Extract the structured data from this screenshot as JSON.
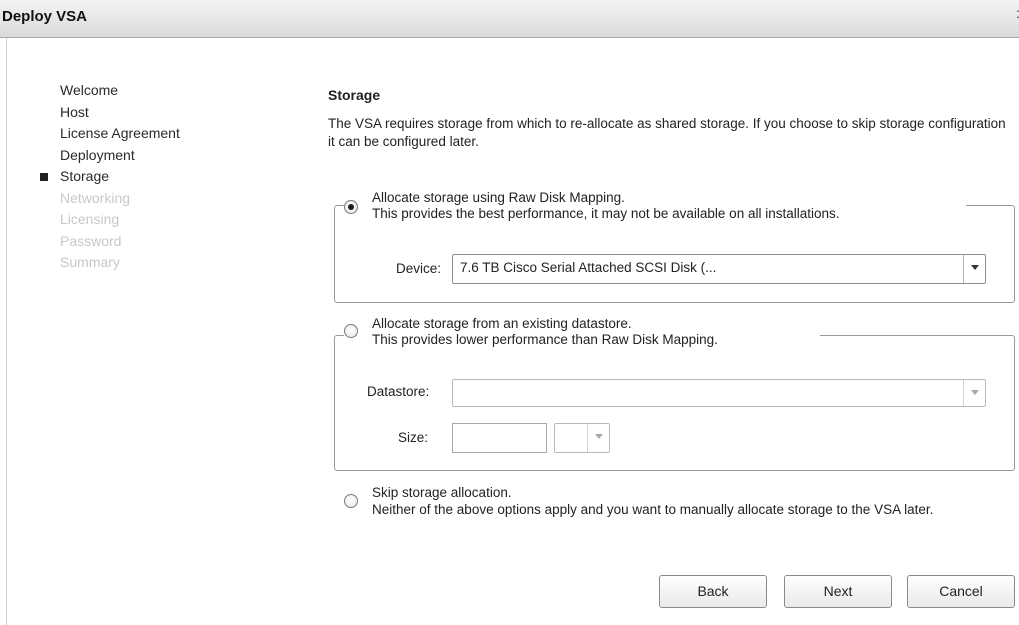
{
  "window": {
    "title": "Deploy VSA"
  },
  "nav": {
    "items": [
      {
        "label": "Welcome"
      },
      {
        "label": "Host"
      },
      {
        "label": "License Agreement"
      },
      {
        "label": "Deployment"
      },
      {
        "label": "Storage",
        "current": true
      },
      {
        "label": "Networking",
        "disabled": true
      },
      {
        "label": "Licensing",
        "disabled": true
      },
      {
        "label": "Password",
        "disabled": true
      },
      {
        "label": "Summary",
        "disabled": true
      }
    ]
  },
  "storage": {
    "title": "Storage",
    "description": "The VSA requires storage from which to re-allocate as shared storage. If you choose to skip storage configuration it can be configured later.",
    "raw_disk": {
      "label": "Allocate storage using Raw Disk Mapping.",
      "sublabel": "This provides the best performance, it may not be available on all installations.",
      "selected": true,
      "device_label": "Device:",
      "device_value": "7.6 TB Cisco Serial Attached SCSI Disk (..."
    },
    "datastore": {
      "label": "Allocate storage from an existing datastore.",
      "sublabel": "This provides lower performance than Raw Disk Mapping.",
      "selected": false,
      "datastore_label": "Datastore:",
      "datastore_value": "",
      "size_label": "Size:",
      "size_value": "",
      "unit_value": ""
    },
    "skip": {
      "label": "Skip storage allocation.",
      "sublabel": "Neither of the above options apply and you want to manually allocate storage to the VSA later.",
      "selected": false
    }
  },
  "buttons": {
    "back": "Back",
    "next": "Next",
    "cancel": "Cancel"
  }
}
